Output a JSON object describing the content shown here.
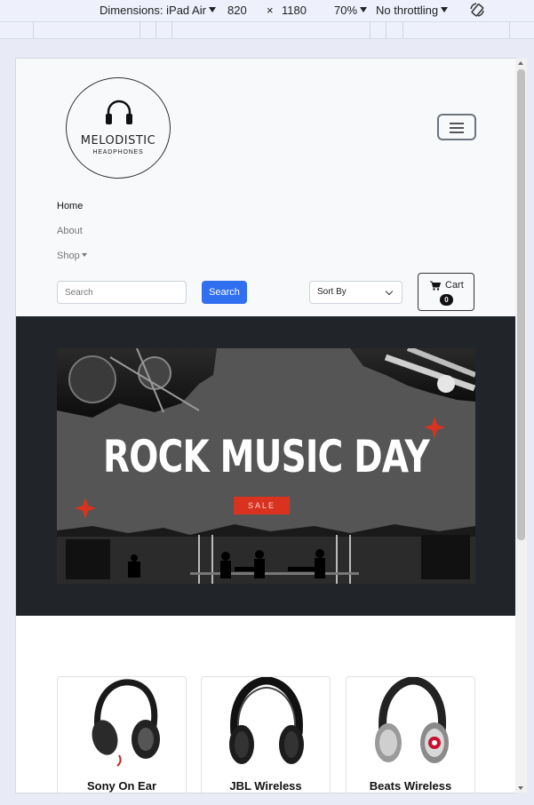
{
  "devtools": {
    "dimensions_label": "Dimensions: iPad Air",
    "width": "820",
    "times": "×",
    "height": "1180",
    "zoom": "70%",
    "throttling": "No throttling",
    "rotate_icon": "rotate-icon"
  },
  "logo": {
    "name": "MELODISTIC",
    "sub": "HEADPHONES"
  },
  "nav": {
    "items": [
      {
        "label": "Home"
      },
      {
        "label": "About"
      },
      {
        "label": "Shop"
      }
    ]
  },
  "toolbar": {
    "search_placeholder": "Search",
    "search_button": "Search",
    "sort_label": "Sort By",
    "cart_label": "Cart",
    "cart_count": "0"
  },
  "banner": {
    "title": "ROCK MUSIC DAY",
    "sale": "SALE"
  },
  "products": [
    {
      "name": "Sony On Ear"
    },
    {
      "name": "JBL Wireless"
    },
    {
      "name": "Beats Wireless"
    }
  ],
  "colors": {
    "primary": "#2f6ff0",
    "hero_bg": "#212529",
    "sale_red": "#d9321f"
  }
}
